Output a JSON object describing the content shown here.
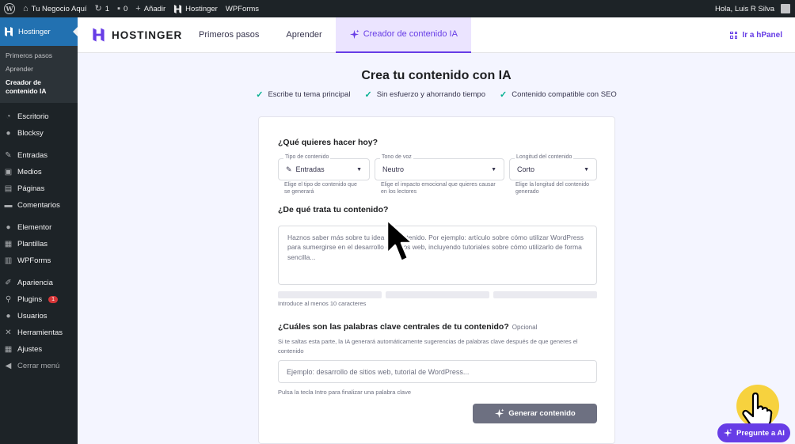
{
  "adminbar": {
    "site_name": "Tu Negocio Aquí",
    "updates_count": "1",
    "comments_count": "0",
    "add_new": "Añadir",
    "hostinger": "Hostinger",
    "wpforms": "WPForms",
    "greeting": "Hola, Luis R Silva"
  },
  "sidebar": {
    "current": "Hostinger",
    "submenu": [
      "Primeros pasos",
      "Aprender",
      "Creador de contenido IA"
    ],
    "group1": [
      {
        "label": "Escritorio",
        "icon": "dashboard-icon"
      },
      {
        "label": "Blocksy",
        "icon": "blocksy-icon"
      }
    ],
    "group2": [
      {
        "label": "Entradas",
        "icon": "pin-icon"
      },
      {
        "label": "Medios",
        "icon": "media-icon"
      },
      {
        "label": "Páginas",
        "icon": "pages-icon"
      },
      {
        "label": "Comentarios",
        "icon": "comments-icon"
      }
    ],
    "group3": [
      {
        "label": "Elementor",
        "icon": "elementor-icon"
      },
      {
        "label": "Plantillas",
        "icon": "templates-icon"
      },
      {
        "label": "WPForms",
        "icon": "wpforms-icon"
      }
    ],
    "group4": [
      {
        "label": "Apariencia",
        "icon": "appearance-icon"
      },
      {
        "label": "Plugins",
        "icon": "plugins-icon",
        "badge": "1"
      },
      {
        "label": "Usuarios",
        "icon": "users-icon"
      },
      {
        "label": "Herramientas",
        "icon": "tools-icon"
      },
      {
        "label": "Ajustes",
        "icon": "settings-icon"
      }
    ],
    "collapse": "Cerrar menú"
  },
  "topnav": {
    "brand": "HOSTINGER",
    "tabs": [
      "Primeros pasos",
      "Aprender",
      "Creador de contenido IA"
    ],
    "active_tab": 2,
    "hpanel": "Ir a hPanel",
    "accent": "#673de6"
  },
  "main": {
    "heading": "Crea tu contenido con IA",
    "checks": [
      "Escribe tu tema principal",
      "Sin esfuerzo y ahorrando tiempo",
      "Contenido compatible con SEO"
    ]
  },
  "form": {
    "q1": "¿Qué quieres hacer hoy?",
    "fields": [
      {
        "label": "Tipo de contenido",
        "value": "Entradas",
        "help": "Elige el tipo de contenido que se generará"
      },
      {
        "label": "Tono de voz",
        "value": "Neutro",
        "help": "Elige el impacto emocional que quieres causar en los lectores"
      },
      {
        "label": "Longitud del contenido",
        "value": "Corto",
        "help": "Elige la longitud del contenido generado"
      }
    ],
    "q2": "¿De qué trata tu contenido?",
    "textarea_placeholder": "Haznos saber más sobre tu idea de contenido. Por ejemplo: artículo sobre cómo utilizar WordPress para sumergirse en el desarrollo de sitios web, incluyendo tutoriales sobre cómo utilizarlo de forma sencilla...",
    "min_chars": "Introduce al menos 10 caracteres",
    "q3": "¿Cuáles son las palabras clave centrales de tu contenido?",
    "q3_optional": "Opcional",
    "q3_help": "Si te saltas esta parte, la IA generará automáticamente sugerencias de palabras clave después de que generes el contenido",
    "keywords_placeholder": "Ejemplo: desarrollo de sitios web, tutorial de WordPress...",
    "keywords_hint": "Pulsa la tecla Intro para finalizar una palabra clave",
    "generate": "Generar contenido"
  },
  "ai_button": "Pregunte a AI"
}
